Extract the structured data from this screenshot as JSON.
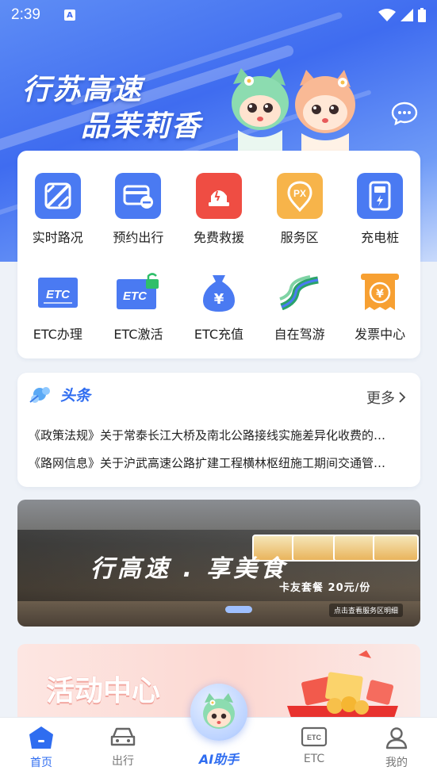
{
  "status_bar": {
    "time": "2:39",
    "a_badge": "A"
  },
  "hero": {
    "slogan_line1": "行苏高速",
    "slogan_line2": "品茉莉香"
  },
  "quick_actions": [
    {
      "label": "实时路况",
      "icon": "map-road-icon",
      "color": "#4a7af2"
    },
    {
      "label": "预约出行",
      "icon": "card-minus-icon",
      "color": "#4a7af2"
    },
    {
      "label": "免费救援",
      "icon": "rescue-siren-icon",
      "color": "#ef4d43"
    },
    {
      "label": "服务区",
      "icon": "px-location-icon",
      "color": "#f7b44a"
    },
    {
      "label": "充电桩",
      "icon": "charging-pile-icon",
      "color": "#4a7af2"
    },
    {
      "label": "ETC办理",
      "icon": "etc-card-icon",
      "color": "#4a7af2"
    },
    {
      "label": "ETC激活",
      "icon": "etc-unlock-icon",
      "color": "#4a7af2"
    },
    {
      "label": "ETC充值",
      "icon": "money-bag-icon",
      "color": "#4a7af2"
    },
    {
      "label": "自在驾游",
      "icon": "road-ribbon-icon",
      "color": "#2aa36a"
    },
    {
      "label": "发票中心",
      "icon": "invoice-icon",
      "color": "#f7a032"
    }
  ],
  "news": {
    "title": "头条",
    "more_label": "更多",
    "items": [
      "《政策法规》关于常泰长江大桥及南北公路接线实施差异化收费的通知",
      "《路网信息》关于沪武高速公路扩建工程横林枢纽施工期间交通管制的公告"
    ]
  },
  "banner": {
    "title": "行高速 . 享美食",
    "subtitle": "卡友套餐  20元/份",
    "small": "点击查看服务区明细"
  },
  "activity": {
    "title": "活动中心"
  },
  "tabbar": {
    "home": "首页",
    "travel": "出行",
    "ai": "AI助手",
    "etc": "ETC",
    "mine": "我的"
  },
  "colors": {
    "accent": "#2f6df0",
    "hero_top": "#5e8df5"
  }
}
